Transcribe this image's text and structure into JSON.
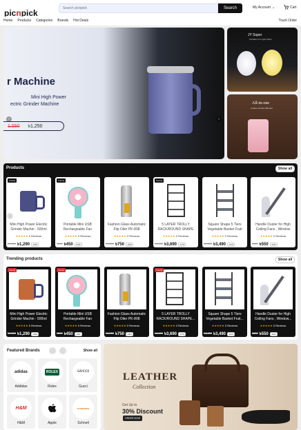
{
  "header": {
    "logo_a": "pic",
    "logo_n": "n",
    "logo_b": "pick",
    "search_placeholder": "Search pickpick",
    "search_button": "Search",
    "account": "My Account",
    "account_caret": "⌄",
    "cart": "Cart"
  },
  "nav": {
    "items": [
      "Home",
      "Products",
      "Categories",
      "Brands",
      "Hot Deals"
    ],
    "track": "Track Order"
  },
  "hero": {
    "heading": "r Machine",
    "line1": "Mini High Power",
    "line2": "ectric Grinder Machine",
    "old_price": "1,550",
    "new_price": "৳1,250",
    "prev": "‹",
    "next": "›",
    "slides": 4,
    "active_slide": 2
  },
  "banners": {
    "b1_title": "JY Super",
    "b1_sub": "Portable Lint Light Shirts",
    "b2_title": "All-in-one",
    "b2_sub": "Cuisine Grinder Blender"
  },
  "products": {
    "title": "Products",
    "show_all": "Show all",
    "arrow": "‹",
    "items": [
      {
        "badge": "Trendy",
        "name": "Mini High Power Electric Grinder Machin - 500ml",
        "stars": "★★★★★",
        "reviews": "0 Reviews",
        "old": "৳1,600",
        "new": "৳1,290",
        "disc": "-20%"
      },
      {
        "badge": "Trendy",
        "name": "Portable Mini USB Rechargeable Fan",
        "stars": "★★★★★",
        "reviews": "0 Reviews",
        "old": "৳650",
        "new": "৳450",
        "disc": "-31%"
      },
      {
        "badge": "",
        "name": "Fashion Glass Automatic Flip Oiler PK-808",
        "stars": "★★★★★",
        "reviews": "0 Reviews",
        "old": "৳1,050",
        "new": "৳750",
        "disc": "-29%"
      },
      {
        "badge": "Trendy",
        "name": "5 LAYER TROLLY RACK/ROUND SHAPE",
        "stars": "★★★★★",
        "reviews": "0 Reviews",
        "old": "৳4,400",
        "new": "৳3,690",
        "disc": "-17%"
      },
      {
        "badge": "",
        "name": "Square Shape 5 Tiers Vegetable Basket Fruit",
        "stars": "★★★★★",
        "reviews": "0 Reviews",
        "old": "৳4,400",
        "new": "৳3,490",
        "disc": "-21%"
      },
      {
        "badge": "",
        "name": "Handle Duster for High Ceiling Fans , Window",
        "stars": "★★★★★",
        "reviews": "0 Reviews",
        "old": "৳800",
        "new": "৳550",
        "disc": "-31%"
      }
    ]
  },
  "trending": {
    "title": "Trending products",
    "show_all": "Show all",
    "items": [
      {
        "badge": "Trendy",
        "name": "Mini High Power Electric Grinder Machin - 500ml",
        "stars": "★★★★★",
        "reviews": "0 Reviews",
        "old": "৳1,600",
        "new": "৳1,290",
        "disc": "-20%"
      },
      {
        "badge": "Trendy",
        "name": "Portable Mini USB Rechargeable Fan",
        "stars": "★★★★★",
        "reviews": "0 Reviews",
        "old": "৳650",
        "new": "৳450",
        "disc": "-31%"
      },
      {
        "badge": "",
        "name": "Fashion Glass Automatic Flip Oiler PK-808",
        "stars": "★★★★★",
        "reviews": "0 Reviews",
        "old": "৳1,050",
        "new": "৳750",
        "disc": "-29%"
      },
      {
        "badge": "Trendy",
        "name": "5 LAYER TROLLY RACK/ROUND SHAPE...",
        "stars": "★★★★★",
        "reviews": "0 Reviews",
        "old": "৳4,400",
        "new": "৳3,690",
        "disc": "-17%"
      },
      {
        "badge": "",
        "name": "Square Shape 5 Tiers Vegetable Basket Fruit...",
        "stars": "★★★★★",
        "reviews": "0 Reviews",
        "old": "৳4,400",
        "new": "৳3,490",
        "disc": "-21%"
      },
      {
        "badge": "",
        "name": "Handle Duster for High Ceiling Fans , Window...",
        "stars": "★★★★★",
        "reviews": "0 Reviews",
        "old": "৳800",
        "new": "৳550",
        "disc": "-31%"
      }
    ]
  },
  "brands": {
    "title": "Featured Brands",
    "show_all": "Show all",
    "items": [
      {
        "logo": "adidas",
        "name": "Addidas"
      },
      {
        "logo": "ROLEX",
        "name": "Rolex"
      },
      {
        "logo": "GUCCI",
        "name": "Gucci"
      },
      {
        "logo": "H&M",
        "name": "H&M"
      },
      {
        "logo": "",
        "name": "Apple"
      },
      {
        "logo": "SCHNEIDER",
        "name": "Schneil"
      }
    ]
  },
  "leather": {
    "title": "LEATHER",
    "subtitle": "Collection",
    "upto": "Get Up to",
    "discount": "30% Discount",
    "button": "ORDER NOW"
  }
}
